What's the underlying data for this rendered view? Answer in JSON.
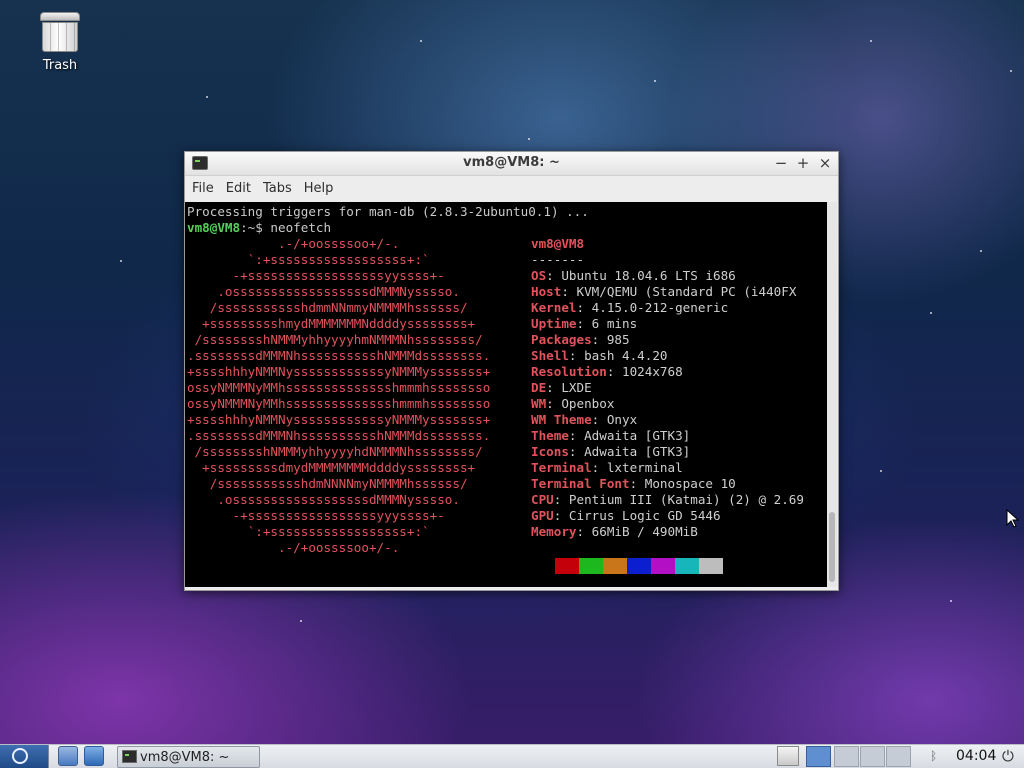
{
  "desktop": {
    "trash_label": "Trash"
  },
  "window": {
    "title": "vm8@VM8: ~",
    "controls": {
      "minimize": "−",
      "maximize": "+",
      "close": "×"
    },
    "menu": [
      "File",
      "Edit",
      "Tabs",
      "Help"
    ]
  },
  "terminal": {
    "line1": "Processing triggers for man-db (2.8.3-2ubuntu0.1) ...",
    "prompt_user": "vm8@VM8",
    "prompt_sep": ":~$ ",
    "command": "neofetch",
    "userhost": "vm8@VM8",
    "underline": "-------",
    "info": [
      {
        "key": "OS",
        "value": "Ubuntu 18.04.6 LTS i686"
      },
      {
        "key": "Host",
        "value": "KVM/QEMU (Standard PC (i440FX"
      },
      {
        "key": "Kernel",
        "value": "4.15.0-212-generic"
      },
      {
        "key": "Uptime",
        "value": "6 mins"
      },
      {
        "key": "Packages",
        "value": "985"
      },
      {
        "key": "Shell",
        "value": "bash 4.4.20"
      },
      {
        "key": "Resolution",
        "value": "1024x768"
      },
      {
        "key": "DE",
        "value": "LXDE"
      },
      {
        "key": "WM",
        "value": "Openbox"
      },
      {
        "key": "WM Theme",
        "value": "Onyx"
      },
      {
        "key": "Theme",
        "value": "Adwaita [GTK3]"
      },
      {
        "key": "Icons",
        "value": "Adwaita [GTK3]"
      },
      {
        "key": "Terminal",
        "value": "lxterminal"
      },
      {
        "key": "Terminal Font",
        "value": "Monospace 10"
      },
      {
        "key": "CPU",
        "value": "Pentium III (Katmai) (2) @ 2.69"
      },
      {
        "key": "GPU",
        "value": "Cirrus Logic GD 5446"
      },
      {
        "key": "Memory",
        "value": "66MiB / 490MiB"
      }
    ],
    "logo": [
      "            .-/+oossssoo+/-.",
      "        `:+ssssssssssssssssss+:`",
      "      -+ssssssssssssssssssyyssss+-",
      "    .ossssssssssssssssssdMMMNysssso.",
      "   /ssssssssssshdmmNNmmyNMMMMhssssss/",
      "  +ssssssssshmydMMMMMMMNddddyssssssss+",
      " /sssssssshNMMMyhhyyyyhmNMMMNhssssssss/",
      ".ssssssssdMMMNhsssssssssshNMMMdssssssss.",
      "+sssshhhyNMMNyssssssssssssyNMMMysssssss+",
      "ossyNMMMNyMMhsssssssssssssshmmmhssssssso",
      "ossyNMMMNyMMhsssssssssssssshmmmhssssssso",
      "+sssshhhyNMMNyssssssssssssyNMMMysssssss+",
      ".ssssssssdMMMNhsssssssssshNMMMdssssssss.",
      " /sssssssshNMMMyhhyyyyhdNMMMNhssssssss/",
      "  +sssssssssdmydMMMMMMMMddddyssssssss+",
      "   /ssssssssssshdmNNNNmyNMMMMhssssss/",
      "    .ossssssssssssssssssdMMMNysssso.",
      "      -+sssssssssssssssssyyyssss+-",
      "        `:+ssssssssssssssssss+:`",
      "            .-/+oossssoo+/-."
    ],
    "palette": [
      "#c4000b",
      "#1db81d",
      "#c9751a",
      "#0b1fd0",
      "#b30fc4",
      "#16b6bb",
      "#bdbdbd"
    ]
  },
  "taskbar": {
    "task_label": "vm8@VM8: ~",
    "clock": "04:04"
  }
}
